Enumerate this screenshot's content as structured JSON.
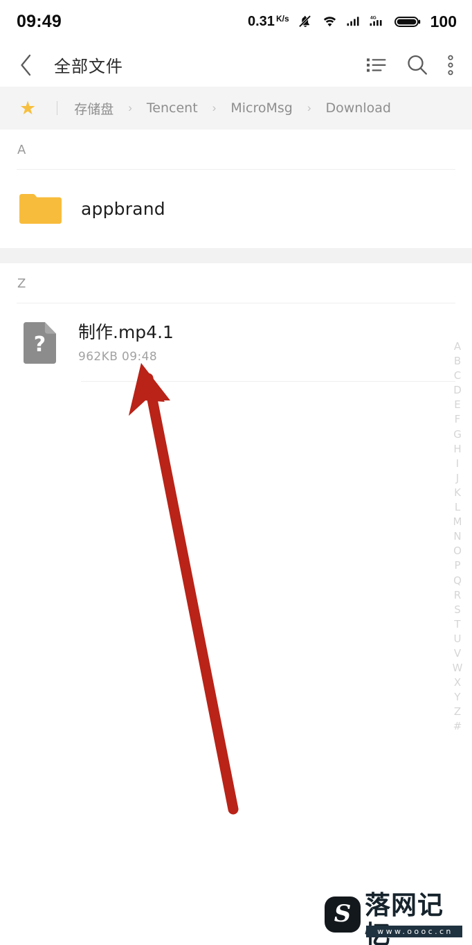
{
  "status_bar": {
    "time": "09:49",
    "network_speed": "0.31",
    "network_unit": "K/s",
    "battery_level": "100",
    "icons": [
      "mute-icon",
      "wifi-icon",
      "signal-sim1-icon",
      "signal-sim2-4g-icon",
      "battery-icon"
    ],
    "signal_label": "4G"
  },
  "app_bar": {
    "back_label": "back-icon",
    "title": "全部文件",
    "actions": [
      {
        "name": "list-view-icon",
        "label": "list-view"
      },
      {
        "name": "search-icon",
        "label": "search"
      },
      {
        "name": "more-options-icon",
        "label": "more"
      }
    ]
  },
  "breadcrumb": {
    "star_label": "★",
    "separator": "›",
    "items": [
      "存储盘",
      "Tencent",
      "MicroMsg",
      "Download"
    ]
  },
  "sections": [
    {
      "letter": "A",
      "items": [
        {
          "kind": "folder",
          "name": "appbrand",
          "meta": ""
        }
      ]
    },
    {
      "letter": "Z",
      "items": [
        {
          "kind": "file",
          "name": "制作.mp4.1",
          "meta": "962KB  09:48",
          "icon_glyph": "?"
        }
      ]
    }
  ],
  "alphabet_index": [
    "A",
    "B",
    "C",
    "D",
    "E",
    "F",
    "G",
    "H",
    "I",
    "J",
    "K",
    "L",
    "M",
    "N",
    "O",
    "P",
    "Q",
    "R",
    "S",
    "T",
    "U",
    "V",
    "W",
    "X",
    "Y",
    "Z",
    "#"
  ],
  "annotation": {
    "type": "arrow",
    "color": "#b92318",
    "points_to": "file-meta-962KB-0948"
  },
  "watermark": {
    "logo_glyph": "S",
    "title": "落网记忆",
    "url": "www.oooc.cn"
  },
  "colors": {
    "folder": "#f8bc3c",
    "star": "#f6bf3e",
    "file_icon": "#8c8c8c",
    "crumb_bg": "#f4f4f4",
    "arrow": "#b92318",
    "text_primary": "#1d1d1d",
    "text_secondary": "#a2a2a2"
  }
}
